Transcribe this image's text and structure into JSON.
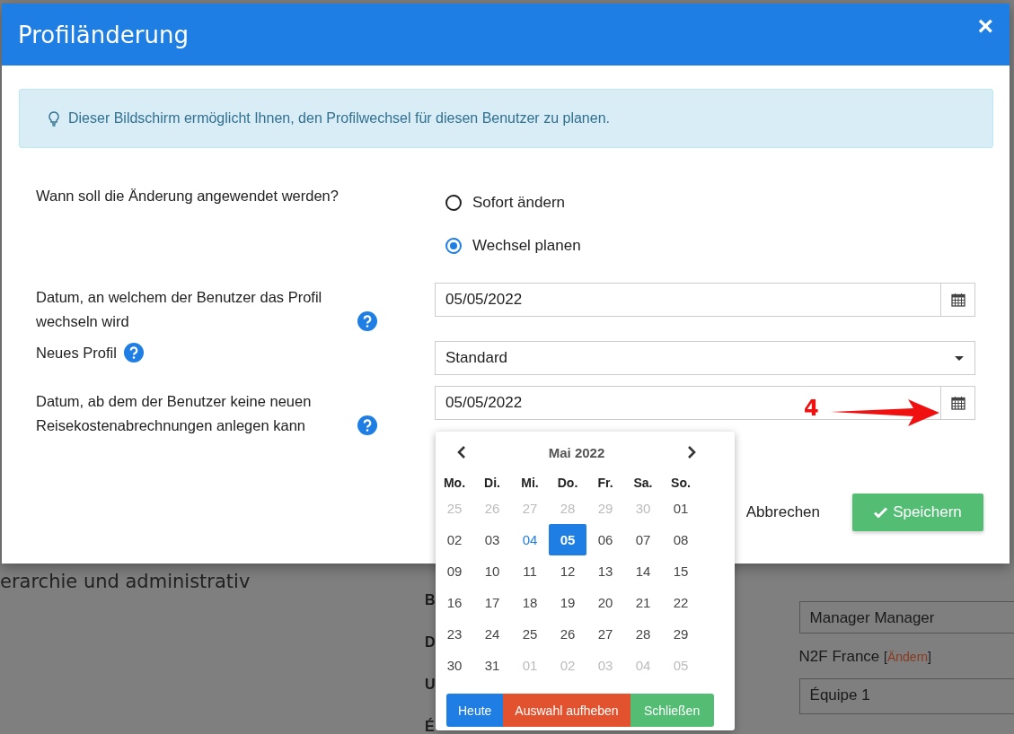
{
  "background": {
    "heading": "erarchie und administrativ",
    "letters": [
      "B",
      "D",
      "U",
      "É"
    ],
    "manager_field": {
      "value": "Manager Manager"
    },
    "company": {
      "text": "N2F France",
      "bracket_open": "[",
      "link": "Ändern",
      "bracket_close": "]"
    },
    "team_field": {
      "value": "Équipe 1"
    }
  },
  "dialog": {
    "title": "Profiländerung",
    "close": "×",
    "info": "Dieser Bildschirm ermöglicht Ihnen, den Profilwechsel für diesen Benutzer zu planen.",
    "when": {
      "label": "Wann soll die Änderung angewendet werden?",
      "options": [
        {
          "label": "Sofort ändern",
          "selected": false
        },
        {
          "label": "Wechsel planen",
          "selected": true
        }
      ]
    },
    "switch_date": {
      "label": "Datum, an welchem der Benutzer das Profil wechseln wird",
      "value": "05/05/2022",
      "help": true
    },
    "new_profile": {
      "label": "Neues Profil",
      "value": "Standard",
      "help": true
    },
    "end_date": {
      "label": "Datum, ab dem der Benutzer keine neuen Reisekostenabrechnungen anlegen kann",
      "value": "05/05/2022",
      "help": true
    },
    "cancel": "Abbrechen",
    "save": "Speichern"
  },
  "annotation": {
    "label": "4"
  },
  "calendar": {
    "month": "Mai 2022",
    "weekdays": [
      "Mo.",
      "Di.",
      "Mi.",
      "Do.",
      "Fr.",
      "Sa.",
      "So."
    ],
    "weeks": [
      [
        {
          "d": "25",
          "muted": true,
          "today": false,
          "selected": false
        },
        {
          "d": "26",
          "muted": true,
          "today": false,
          "selected": false
        },
        {
          "d": "27",
          "muted": true,
          "today": false,
          "selected": false
        },
        {
          "d": "28",
          "muted": true,
          "today": false,
          "selected": false
        },
        {
          "d": "29",
          "muted": true,
          "today": false,
          "selected": false
        },
        {
          "d": "30",
          "muted": true,
          "today": false,
          "selected": false
        },
        {
          "d": "01",
          "muted": false,
          "today": false,
          "selected": false
        }
      ],
      [
        {
          "d": "02",
          "muted": false,
          "today": false,
          "selected": false
        },
        {
          "d": "03",
          "muted": false,
          "today": false,
          "selected": false
        },
        {
          "d": "04",
          "muted": false,
          "today": true,
          "selected": false
        },
        {
          "d": "05",
          "muted": false,
          "today": false,
          "selected": true
        },
        {
          "d": "06",
          "muted": false,
          "today": false,
          "selected": false
        },
        {
          "d": "07",
          "muted": false,
          "today": false,
          "selected": false
        },
        {
          "d": "08",
          "muted": false,
          "today": false,
          "selected": false
        }
      ],
      [
        {
          "d": "09",
          "muted": false,
          "today": false,
          "selected": false
        },
        {
          "d": "10",
          "muted": false,
          "today": false,
          "selected": false
        },
        {
          "d": "11",
          "muted": false,
          "today": false,
          "selected": false
        },
        {
          "d": "12",
          "muted": false,
          "today": false,
          "selected": false
        },
        {
          "d": "13",
          "muted": false,
          "today": false,
          "selected": false
        },
        {
          "d": "14",
          "muted": false,
          "today": false,
          "selected": false
        },
        {
          "d": "15",
          "muted": false,
          "today": false,
          "selected": false
        }
      ],
      [
        {
          "d": "16",
          "muted": false,
          "today": false,
          "selected": false
        },
        {
          "d": "17",
          "muted": false,
          "today": false,
          "selected": false
        },
        {
          "d": "18",
          "muted": false,
          "today": false,
          "selected": false
        },
        {
          "d": "19",
          "muted": false,
          "today": false,
          "selected": false
        },
        {
          "d": "20",
          "muted": false,
          "today": false,
          "selected": false
        },
        {
          "d": "21",
          "muted": false,
          "today": false,
          "selected": false
        },
        {
          "d": "22",
          "muted": false,
          "today": false,
          "selected": false
        }
      ],
      [
        {
          "d": "23",
          "muted": false,
          "today": false,
          "selected": false
        },
        {
          "d": "24",
          "muted": false,
          "today": false,
          "selected": false
        },
        {
          "d": "25",
          "muted": false,
          "today": false,
          "selected": false
        },
        {
          "d": "26",
          "muted": false,
          "today": false,
          "selected": false
        },
        {
          "d": "27",
          "muted": false,
          "today": false,
          "selected": false
        },
        {
          "d": "28",
          "muted": false,
          "today": false,
          "selected": false
        },
        {
          "d": "29",
          "muted": false,
          "today": false,
          "selected": false
        }
      ],
      [
        {
          "d": "30",
          "muted": false,
          "today": false,
          "selected": false
        },
        {
          "d": "31",
          "muted": false,
          "today": false,
          "selected": false
        },
        {
          "d": "01",
          "muted": true,
          "today": false,
          "selected": false
        },
        {
          "d": "02",
          "muted": true,
          "today": false,
          "selected": false
        },
        {
          "d": "03",
          "muted": true,
          "today": false,
          "selected": false
        },
        {
          "d": "04",
          "muted": true,
          "today": false,
          "selected": false
        },
        {
          "d": "05",
          "muted": true,
          "today": false,
          "selected": false
        }
      ]
    ],
    "buttons": [
      {
        "label": "Heute",
        "kind": "primary"
      },
      {
        "label": "Auswahl aufheben",
        "kind": "danger"
      },
      {
        "label": "Schließen",
        "kind": "success"
      }
    ]
  }
}
